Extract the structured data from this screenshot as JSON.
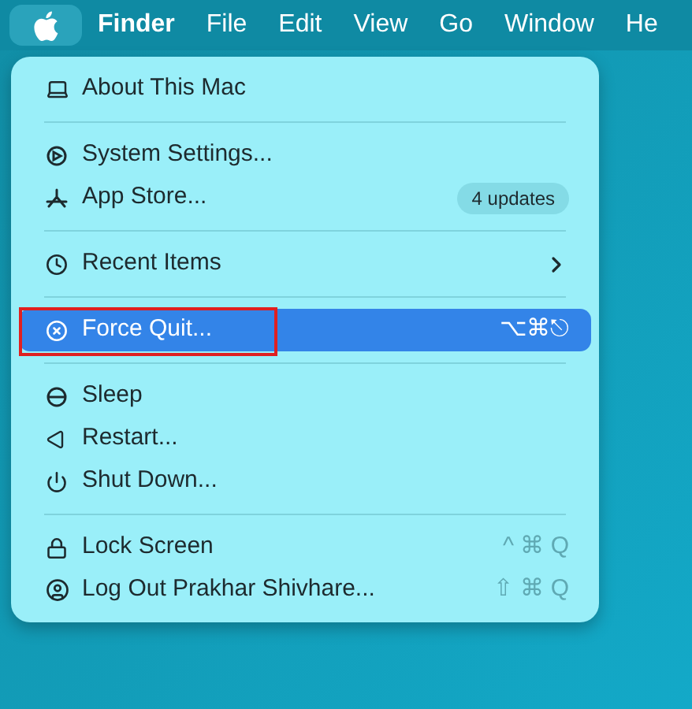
{
  "menu_bar": [
    {
      "kind": "apple",
      "selected": true
    },
    {
      "kind": "app",
      "label": "Finder",
      "selected": false
    },
    {
      "kind": "menu",
      "label": "File",
      "selected": false
    },
    {
      "kind": "menu",
      "label": "Edit",
      "selected": false
    },
    {
      "kind": "menu",
      "label": "View",
      "selected": false
    },
    {
      "kind": "menu",
      "label": "Go",
      "selected": false
    },
    {
      "kind": "menu",
      "label": "Window",
      "selected": false
    },
    {
      "kind": "menu",
      "label": "He",
      "selected": false
    }
  ],
  "menu": {
    "groups": [
      [
        {
          "label": "About This Mac",
          "selected": false,
          "annotated": false
        }
      ],
      [
        {
          "label": "System Settings...",
          "selected": false,
          "annotated": false
        },
        {
          "label": "App Store...",
          "badge": "4 updates",
          "selected": false,
          "annotated": false
        }
      ],
      [
        {
          "label": "Recent Items",
          "submenu": true,
          "selected": false,
          "annotated": false
        }
      ],
      [
        {
          "label": "Force Quit...",
          "shortcut": "⌥⌘⎋",
          "selected": true,
          "annotated": true
        }
      ],
      [
        {
          "label": "Sleep",
          "selected": false,
          "annotated": false
        },
        {
          "label": "Restart...",
          "selected": false,
          "annotated": false
        },
        {
          "label": "Shut Down...",
          "selected": false,
          "annotated": false
        }
      ],
      [
        {
          "label": "Lock Screen",
          "shortcut": "^ ⌘ Q",
          "selected": false,
          "annotated": false
        },
        {
          "label": "Log Out Prakhar Shivhare...",
          "shortcut": "⇧ ⌘ Q",
          "selected": false,
          "annotated": false
        }
      ]
    ]
  }
}
